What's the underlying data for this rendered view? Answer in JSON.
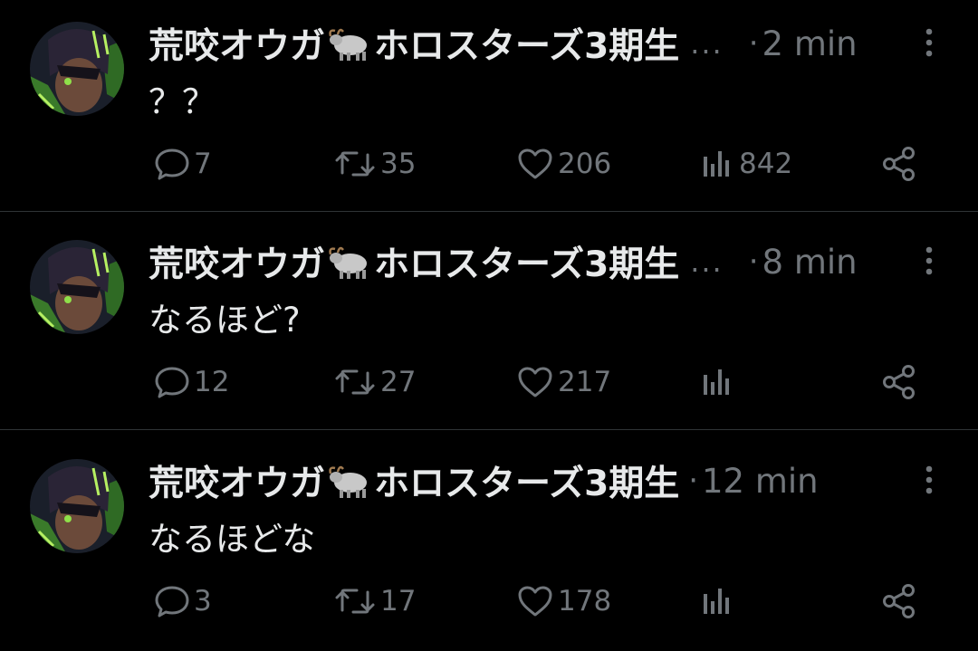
{
  "colors": {
    "background": "#000000",
    "text_primary": "#e7e9ea",
    "text_secondary": "#71767b",
    "divider": "#2f3336"
  },
  "icons": {
    "reply": "speech-bubble-icon",
    "repost": "repost-arrows-icon",
    "like": "heart-icon",
    "views": "bar-chart-icon",
    "share": "share-nodes-icon",
    "more": "vertical-dots-icon",
    "name_emoji": "yak-emoji-icon"
  },
  "posts": [
    {
      "author": {
        "name_part1": "荒咬オウガ",
        "name_part2": "ホロスターズ3期生",
        "truncation": "..."
      },
      "dot": "·",
      "time": "2 min",
      "text": "？？",
      "stats": {
        "replies": "7",
        "reposts": "35",
        "likes": "206",
        "views": "842"
      }
    },
    {
      "author": {
        "name_part1": "荒咬オウガ",
        "name_part2": "ホロスターズ3期生",
        "truncation": "..."
      },
      "dot": "·",
      "time": "8 min",
      "text": "なるほど?",
      "stats": {
        "replies": "12",
        "reposts": "27",
        "likes": "217",
        "views": ""
      }
    },
    {
      "author": {
        "name_part1": "荒咬オウガ",
        "name_part2": "ホロスターズ3期生",
        "truncation": ""
      },
      "dot": "·",
      "time": "12 min",
      "text": "なるほどな",
      "stats": {
        "replies": "3",
        "reposts": "17",
        "likes": "178",
        "views": ""
      }
    }
  ]
}
